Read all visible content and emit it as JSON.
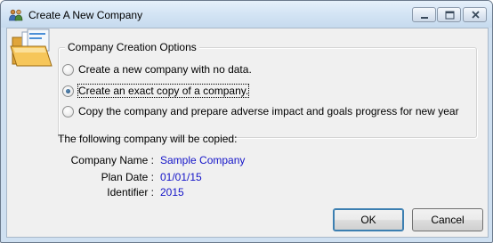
{
  "window": {
    "title": "Create A New Company"
  },
  "options": {
    "legend": "Company Creation Options",
    "items": [
      {
        "label": "Create a new company with no data.",
        "checked": false
      },
      {
        "label": "Create an exact copy of a company.",
        "checked": true
      },
      {
        "label": "Copy the company and prepare adverse impact and goals progress for new year",
        "checked": false
      }
    ]
  },
  "details": {
    "heading": "The following company will be copied:",
    "company_name_label": "Company Name :",
    "company_name_value": "Sample Company",
    "plan_date_label": "Plan Date :",
    "plan_date_value": "01/01/15",
    "identifier_label": "Identifier :",
    "identifier_value": "2015"
  },
  "buttons": {
    "ok": "OK",
    "cancel": "Cancel"
  },
  "colors": {
    "value_text": "#1414c8",
    "titlebar": "#d5e5f5"
  },
  "icons": {
    "title": "people-app-icon",
    "dialog": "open-folder-icon"
  }
}
